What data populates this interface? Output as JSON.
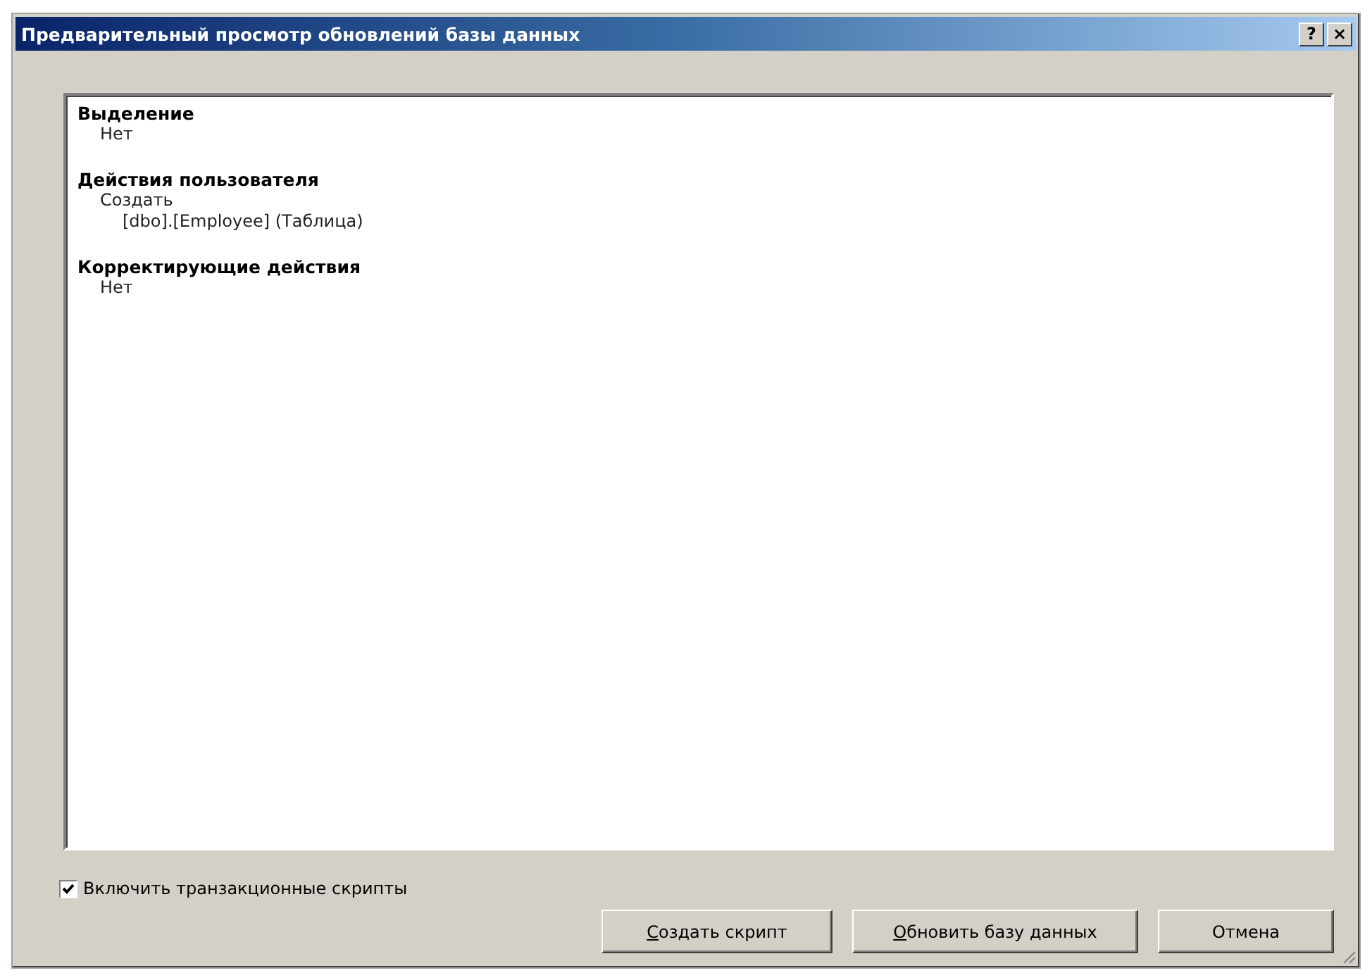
{
  "window": {
    "title": "Предварительный просмотр обновлений базы данных",
    "title_buttons": [
      "?",
      "×"
    ]
  },
  "sections": [
    {
      "heading": "Выделение",
      "children": [
        {
          "label": "Нет"
        }
      ]
    },
    {
      "heading": "Действия пользователя",
      "children": [
        {
          "label": "Создать",
          "children": [
            {
              "label": "[dbo].[Employee] (Таблица)"
            }
          ]
        }
      ]
    },
    {
      "heading": "Корректирующие действия",
      "children": [
        {
          "label": "Нет"
        }
      ]
    }
  ],
  "checkbox": {
    "label": "Включить транзакционные скрипты",
    "checked": true
  },
  "buttons": [
    {
      "label": "Создать скрипт",
      "mnemonic_underlined": true
    },
    {
      "label": "Обновить базу данных",
      "mnemonic_underlined": true
    },
    {
      "label": "Отмена",
      "mnemonic_underlined": false
    }
  ]
}
